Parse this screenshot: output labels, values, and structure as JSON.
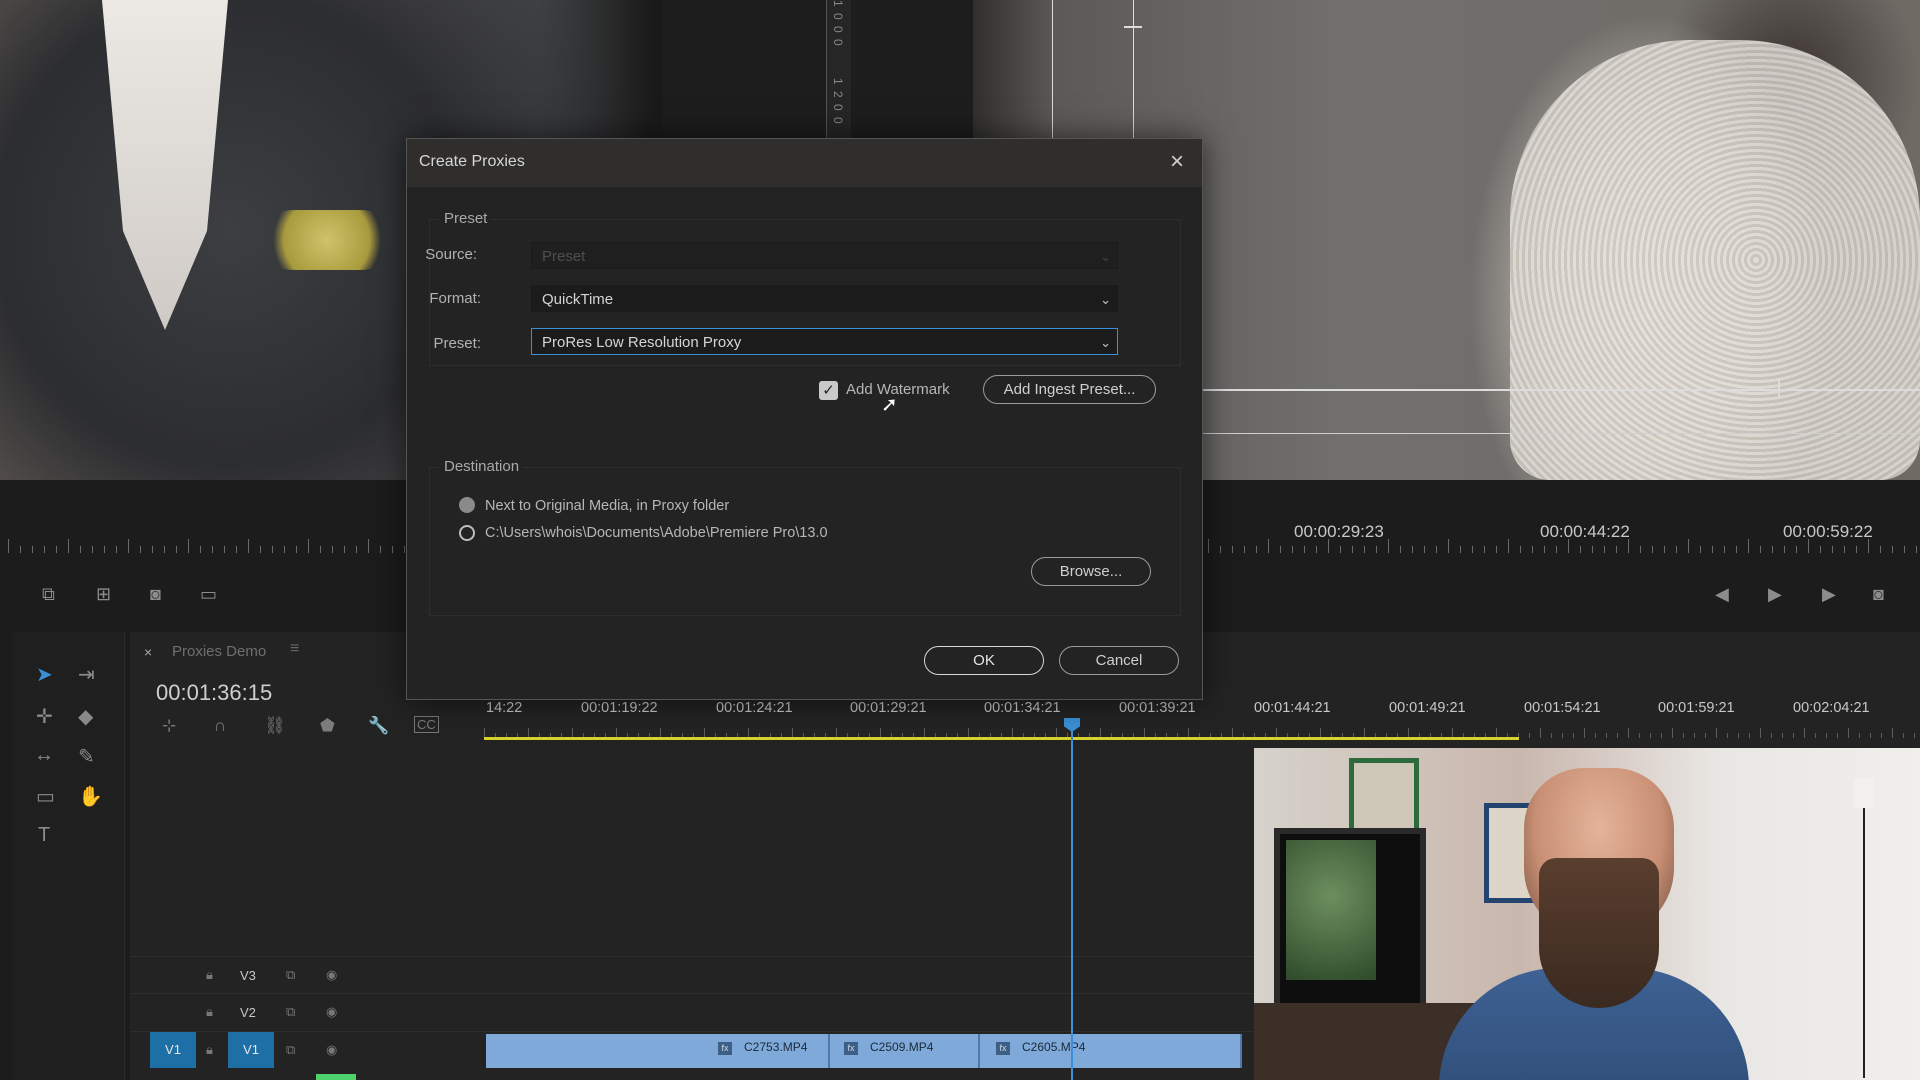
{
  "timecodes": {
    "monitor": [
      "00:00:29:23",
      "00:00:44:22",
      "00:00:59:22"
    ],
    "timeline_current": "00:01:36:15",
    "ruler": [
      "14:22",
      "00:01:19:22",
      "00:01:24:21",
      "00:01:29:21",
      "00:01:34:21",
      "00:01:39:21",
      "00:01:44:21",
      "00:01:49:21",
      "00:01:54:21",
      "00:01:59:21",
      "00:02:04:21"
    ]
  },
  "monitor_ruler_digits": [
    "1",
    "0",
    "0",
    "0",
    "1",
    "2",
    "0",
    "0"
  ],
  "timeline": {
    "tab_close": "×",
    "tab_title": "Proxies Demo",
    "tab_menu": "≡",
    "tracks": [
      {
        "name": "V3"
      },
      {
        "name": "V2"
      },
      {
        "name": "V1",
        "source_patch": "V1"
      }
    ],
    "clips": [
      {
        "label": "C2753.MP4"
      },
      {
        "label": "C2509.MP4"
      },
      {
        "label": "C2605.MP4"
      }
    ]
  },
  "dialog": {
    "title": "Create Proxies",
    "close_icon": "×",
    "preset_group": {
      "legend": "Preset",
      "source_label": "Source:",
      "source_value": "Preset",
      "format_label": "Format:",
      "format_value": "QuickTime",
      "preset_label": "Preset:",
      "preset_value": "ProRes Low Resolution Proxy",
      "watermark_label": "Add Watermark",
      "watermark_checked": true,
      "ingest_button": "Add Ingest Preset..."
    },
    "destination_group": {
      "legend": "Destination",
      "option1": "Next to Original Media, in Proxy folder",
      "option2": "C:\\Users\\whois\\Documents\\Adobe\\Premiere Pro\\13.0",
      "browse_button": "Browse..."
    },
    "ok_button": "OK",
    "cancel_button": "Cancel"
  },
  "colors": {
    "accent": "#3a8fd6",
    "work_area": "#d9d22e",
    "clip": "#7ea9d8",
    "dialog_bg": "#232323"
  }
}
